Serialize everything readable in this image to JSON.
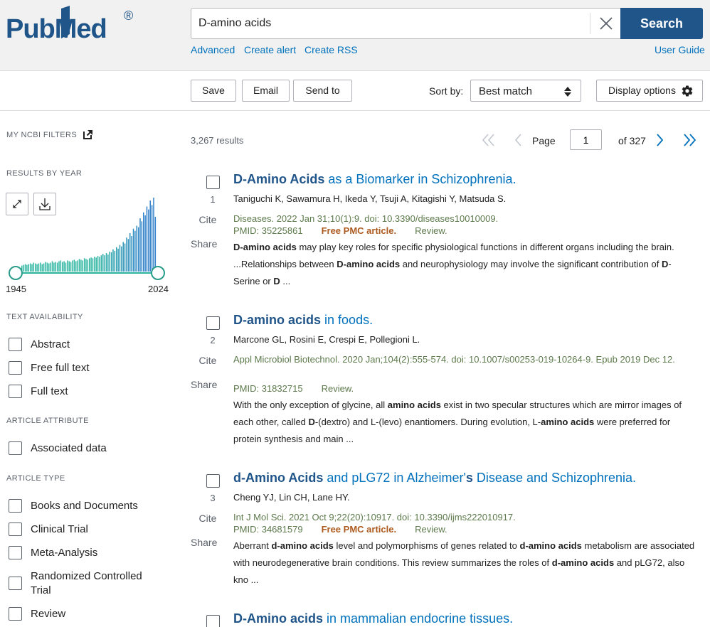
{
  "header": {
    "logo_text": "PubMed",
    "logo_mark": "®",
    "search_value": "D-amino acids",
    "search_button": "Search",
    "links": {
      "advanced": "Advanced",
      "create_alert": "Create alert",
      "create_rss": "Create RSS",
      "user_guide": "User Guide"
    }
  },
  "toolbar": {
    "save": "Save",
    "email": "Email",
    "send_to": "Send to",
    "sort_label": "Sort by:",
    "sort_value": "Best match",
    "display_options": "Display options"
  },
  "sidebar": {
    "my_ncbi_filters": "MY NCBI FILTERS",
    "results_by_year": "RESULTS BY YEAR",
    "year_start": "1945",
    "year_end": "2024",
    "histogram_counts": [
      8,
      9,
      10,
      9,
      10,
      11,
      10,
      12,
      11,
      10,
      11,
      12,
      10,
      11,
      13,
      12,
      11,
      12,
      14,
      12,
      13,
      12,
      14,
      15,
      13,
      14,
      12,
      15,
      14,
      13,
      15,
      16,
      14,
      15,
      17,
      16,
      15,
      18,
      17,
      16,
      18,
      19,
      18,
      20,
      19,
      21,
      20,
      22,
      24,
      22,
      25,
      23,
      27,
      26,
      30,
      28,
      33,
      31,
      36,
      34,
      40,
      38,
      46,
      44,
      52,
      48,
      58,
      55,
      62,
      60,
      72,
      68,
      80,
      76,
      88,
      84,
      96,
      90,
      100,
      74
    ],
    "text_availability": "TEXT AVAILABILITY",
    "text_filters": [
      "Abstract",
      "Free full text",
      "Full text"
    ],
    "article_attribute": "ARTICLE ATTRIBUTE",
    "attribute_filters": [
      "Associated data"
    ],
    "article_type": "ARTICLE TYPE",
    "type_filters": [
      "Books and Documents",
      "Clinical Trial",
      "Meta-Analysis",
      "Randomized Controlled Trial",
      "Review"
    ]
  },
  "results": {
    "count": "3,267 results",
    "page_label": "Page",
    "page_value": "1",
    "page_total": "of 327",
    "cite_label": "Cite",
    "share_label": "Share",
    "items": [
      {
        "num": "1",
        "title_bold": "D-Amino Acids",
        "title_rest": " as a Biomarker in Schizophrenia.",
        "authors": "Taniguchi K, Sawamura H, Ikeda Y, Tsuji A, Kitagishi Y, Matsuda S.",
        "citation": "Diseases. 2022 Jan 31;10(1):9. doi: 10.3390/diseases10010009.",
        "pmid": "PMID: 35225861",
        "free_pmc": "Free PMC article.",
        "review": "Review.",
        "snip_1": "D-amino acids",
        "snip_2": " may play key roles for specific physiological functions in different organs including the brain. ...Relationships between ",
        "snip_3": "D-amino acids",
        "snip_4": " and neurophysiology may involve the significant contribution of ",
        "snip_5": "D",
        "snip_6": "-Serine or ",
        "snip_7": "D",
        "snip_8": " ..."
      },
      {
        "num": "2",
        "title_bold": "D-amino acids",
        "title_rest": " in foods.",
        "authors": "Marcone GL, Rosini E, Crespi E, Pollegioni L.",
        "citation": "Appl Microbiol Biotechnol. 2020 Jan;104(2):555-574. doi: 10.1007/s00253-019-10264-9. Epub 2019 Dec 12.",
        "pmid": "PMID: 31832715",
        "review": "Review.",
        "snip_1": "With the only exception of glycine, all ",
        "snip_2": "amino acids",
        "snip_3": " exist in two specular structures which are mirror images of each other, called ",
        "snip_4": "D",
        "snip_5": "-(dextro) and L-(levo) enantiomers. During evolution, L-",
        "snip_6": "amino acids",
        "snip_7": " were preferred for protein synthesis and main ..."
      },
      {
        "num": "3",
        "title_bold": "d-Amino Acids",
        "title_mid": " and pLG72 in Alzheimer'",
        "title_s": "s",
        "title_rest": " Disease and Schizophrenia.",
        "authors": "Cheng YJ, Lin CH, Lane HY.",
        "citation": "Int J Mol Sci. 2021 Oct 9;22(20):10917. doi: 10.3390/ijms222010917.",
        "pmid": "PMID: 34681579",
        "free_pmc": "Free PMC article.",
        "review": "Review.",
        "snip_1": "Aberrant ",
        "snip_2": "d-amino acids",
        "snip_3": " level and polymorphisms of genes related to ",
        "snip_4": "d-amino acids",
        "snip_5": " metabolism are associated with neurodegenerative brain conditions. This review summarizes the roles of ",
        "snip_6": "d-amino acids",
        "snip_7": " and pLG72, also kno ..."
      },
      {
        "title_bold": "D-Amino acids",
        "title_rest": " in mammalian endocrine tissues."
      }
    ]
  },
  "colors": {
    "brand_blue": "#20558a",
    "link_blue": "#0071bc",
    "histogram_teal": "#2bb5a0",
    "histogram_blue": "#2f7fc8",
    "citation_green": "#5d7a4c",
    "pmc_orange": "#ad5a1f"
  }
}
